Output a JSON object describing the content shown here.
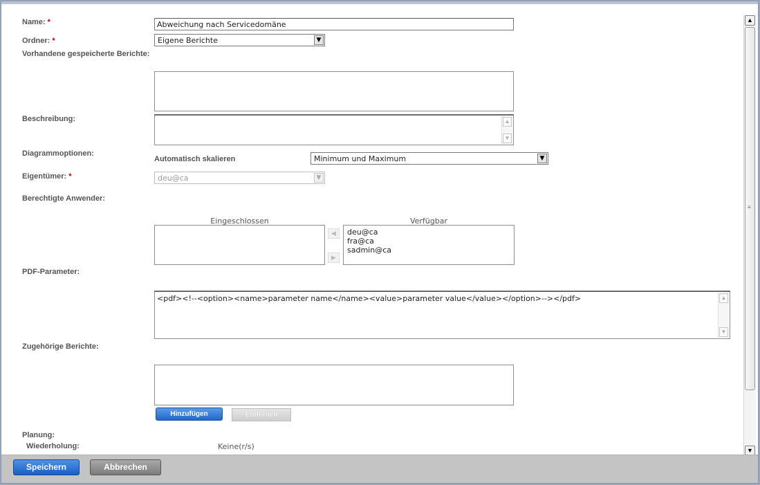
{
  "form": {
    "name_label": "Name:",
    "name_value": "Abweichung nach Servicedomäne",
    "folder_label": "Ordner:",
    "folder_value": "Eigene Berichte",
    "existing_reports_label": "Vorhandene gespeicherte Berichte:",
    "description_label": "Beschreibung:",
    "chart_options_label": "Diagrammoptionen:",
    "auto_scale_label": "Automatisch skalieren",
    "auto_scale_value": "Minimum und Maximum",
    "owner_label": "Eigentümer:",
    "owner_value": "deu@ca",
    "authorized_users_label": "Berechtigte Anwender:",
    "included_header": "Eingeschlossen",
    "available_header": "Verfügbar",
    "available_users": [
      "deu@ca",
      "fra@ca",
      "sadmin@ca"
    ],
    "pdf_params_label": "PDF-Parameter:",
    "pdf_params_value": "<pdf><!--<option><name>parameter name</name><value>parameter value</value></option>--></pdf>",
    "related_reports_label": "Zugehörige Berichte:",
    "add_button": "Hinzufügen",
    "remove_button": "Entfernen",
    "planning_label": "Planung:",
    "repeat_label": "Wiederholung:",
    "repeat_value": "Keine(r/s)",
    "required_marker": "*"
  },
  "footer": {
    "save_button": "Speichern",
    "cancel_button": "Abbrechen"
  },
  "icons": {
    "dropdown": "chevron-down-icon",
    "scroll_up": "chevron-up-icon",
    "scroll_down": "chevron-down-icon",
    "move_left": "arrow-left-icon",
    "move_right": "arrow-right-icon"
  },
  "colors": {
    "primary_button": "#2168cc",
    "required": "#c00000"
  }
}
